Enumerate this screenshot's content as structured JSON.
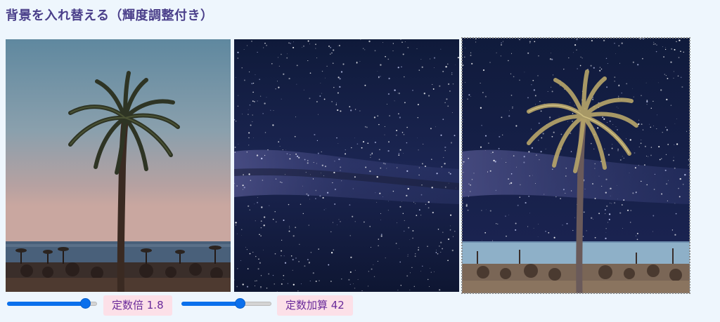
{
  "page": {
    "title": "背景を入れ替える（輝度調整付き）"
  },
  "images": [
    {
      "name": "palm-photo"
    },
    {
      "name": "milky-way-photo"
    },
    {
      "name": "composite-result"
    }
  ],
  "controls": {
    "multiplier": {
      "label": "定数倍 1.8",
      "value": 1.8,
      "level_fraction": 0.87
    },
    "addend": {
      "label": "定数加算 42",
      "value": 42,
      "level_fraction": 0.65
    }
  },
  "colors": {
    "accent": "#0b70ec",
    "badge_bg": "#fce0e8",
    "badge_text": "#6a2a9a",
    "title": "#4a3f8a",
    "page_bg": "#eef6fd"
  }
}
